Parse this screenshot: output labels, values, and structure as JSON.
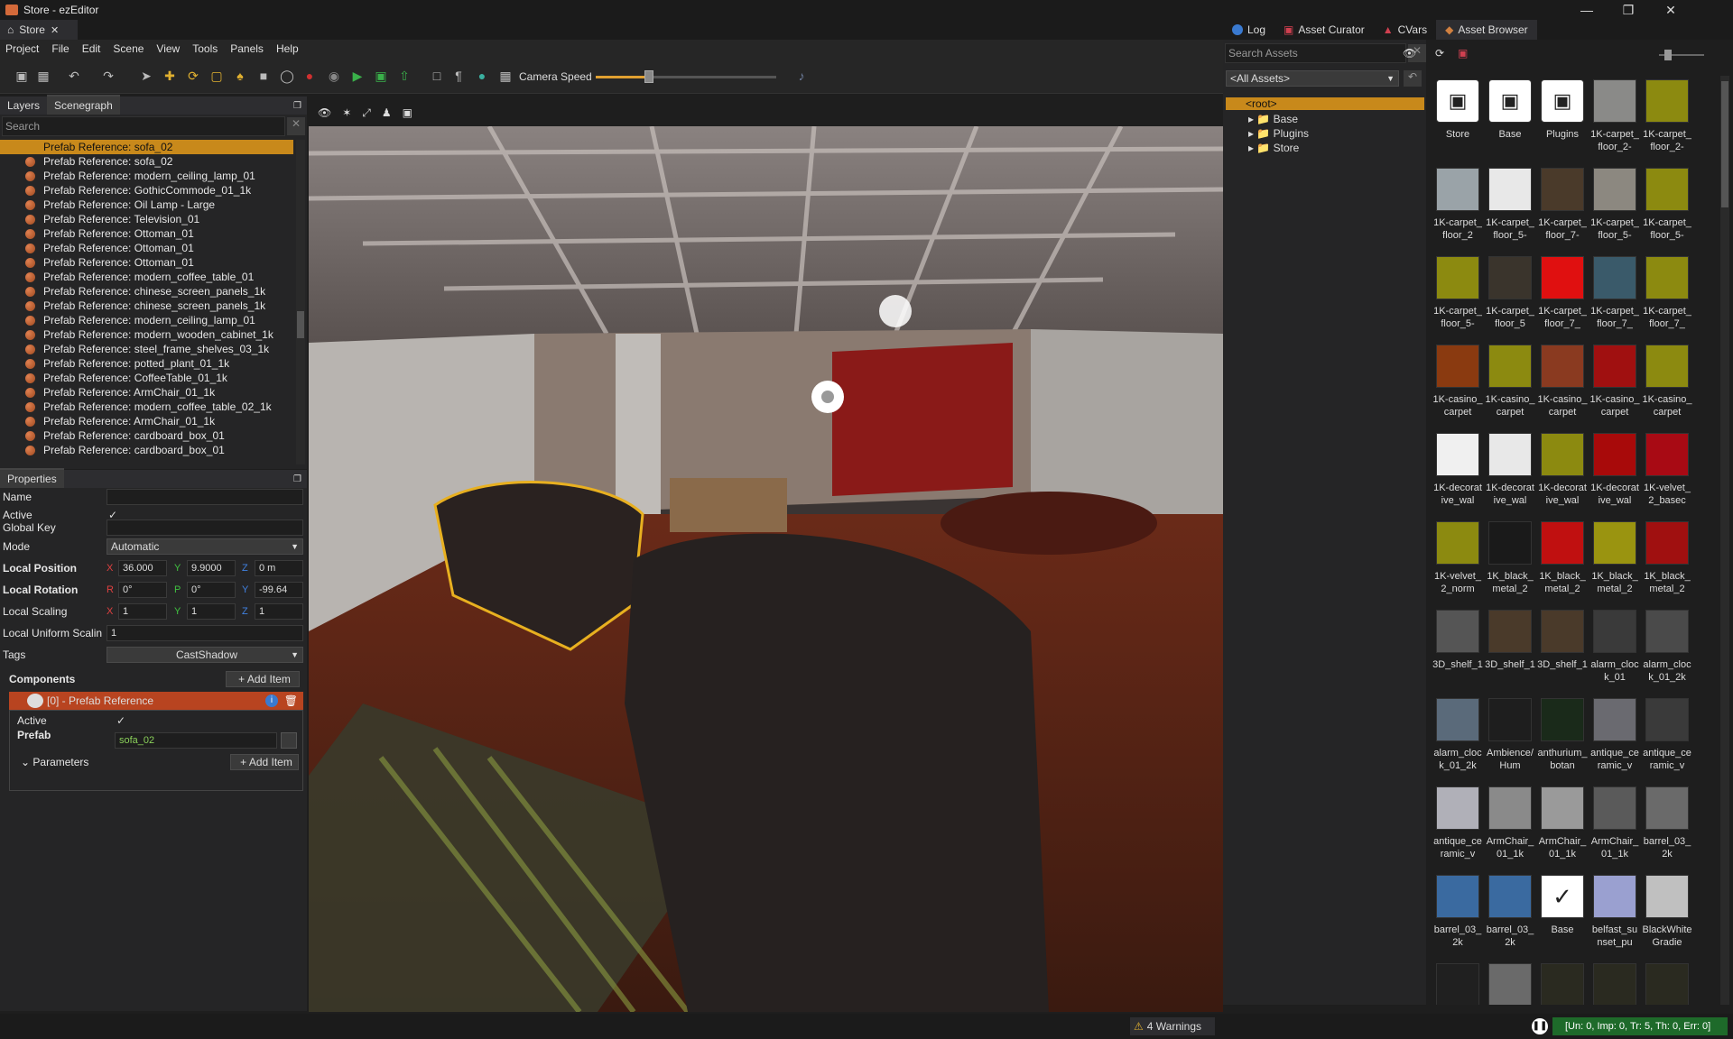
{
  "window": {
    "title": "Store - ezEditor",
    "doc_tab": "Store"
  },
  "menu": [
    "Project",
    "File",
    "Edit",
    "Scene",
    "View",
    "Tools",
    "Panels",
    "Help"
  ],
  "toolbar": {
    "camera_speed_label": "Camera Speed",
    "camera_speed_level": 0.3
  },
  "left_panel": {
    "tabs": [
      "Layers",
      "Scenegraph"
    ],
    "active_tab": "Scenegraph",
    "search_placeholder": "Search",
    "items": [
      "Prefab Reference: sofa_02",
      "Prefab Reference: sofa_02",
      "Prefab Reference: modern_ceiling_lamp_01",
      "Prefab Reference: GothicCommode_01_1k",
      "Prefab Reference: Oil Lamp - Large",
      "Prefab Reference: Television_01",
      "Prefab Reference: Ottoman_01",
      "Prefab Reference: Ottoman_01",
      "Prefab Reference: Ottoman_01",
      "Prefab Reference: modern_coffee_table_01",
      "Prefab Reference: chinese_screen_panels_1k",
      "Prefab Reference: chinese_screen_panels_1k",
      "Prefab Reference: modern_ceiling_lamp_01",
      "Prefab Reference: modern_wooden_cabinet_1k",
      "Prefab Reference: steel_frame_shelves_03_1k",
      "Prefab Reference: potted_plant_01_1k",
      "Prefab Reference: CoffeeTable_01_1k",
      "Prefab Reference: ArmChair_01_1k",
      "Prefab Reference: modern_coffee_table_02_1k",
      "Prefab Reference: ArmChair_01_1k",
      "Prefab Reference: cardboard_box_01",
      "Prefab Reference: cardboard_box_01"
    ]
  },
  "properties": {
    "title": "Properties",
    "name_label": "Name",
    "active_label": "Active",
    "global_key_label": "Global Key",
    "mode_label": "Mode",
    "mode_value": "Automatic",
    "local_position_label": "Local Position",
    "pos": {
      "x": "36.000",
      "y": "9.9000",
      "z": "0 m"
    },
    "local_rotation_label": "Local Rotation",
    "rot": {
      "r": "0°",
      "p": "0°",
      "y": "-99.64"
    },
    "local_scaling_label": "Local Scaling",
    "scale": {
      "x": "1",
      "y": "1",
      "z": "1"
    },
    "uniform_label": "Local Uniform Scalin",
    "uniform_value": "1",
    "tags_label": "Tags",
    "tags_value": "CastShadow",
    "components_label": "Components",
    "add_item": "Add Item",
    "component_title": "[0] - Prefab Reference",
    "comp_active": "Active",
    "prefab_label": "Prefab",
    "prefab_value": "sofa_02",
    "parameters_label": "Parameters"
  },
  "right_tabs": [
    "Log",
    "Asset Curator",
    "CVars",
    "Asset Browser"
  ],
  "assets": {
    "search_placeholder": "Search Assets",
    "filter": "<All Assets>",
    "root": "<root>",
    "tree": [
      "Base",
      "Plugins",
      "Store"
    ],
    "tiles": [
      {
        "name": "Store",
        "kind": "folder"
      },
      {
        "name": "Base",
        "kind": "folder"
      },
      {
        "name": "Plugins",
        "kind": "folder"
      },
      {
        "name": "1K-carpet_floor_2-",
        "color": "#8a8a88"
      },
      {
        "name": "1K-carpet_floor_2-",
        "color": "#8c8a10"
      },
      {
        "name": "1K-carpet_floor_2",
        "color": "#9aa3a8"
      },
      {
        "name": "1K-carpet_floor_5-",
        "color": "#e8e8e8"
      },
      {
        "name": "1K-carpet_floor_7-",
        "color": "#4a3a2a"
      },
      {
        "name": "1K-carpet_floor_5-",
        "color": "#8c8880"
      },
      {
        "name": "1K-carpet_floor_5-",
        "color": "#8c8a10"
      },
      {
        "name": "1K-carpet_floor_5-",
        "color": "#8c8a10"
      },
      {
        "name": "1K-carpet_floor_5",
        "color": "#3a342c"
      },
      {
        "name": "1K-carpet_floor_7_",
        "color": "#e01010"
      },
      {
        "name": "1K-carpet_floor_7_",
        "color": "#3a5a6a"
      },
      {
        "name": "1K-carpet_floor_7_",
        "color": "#8c8a10"
      },
      {
        "name": "1K-casino_carpet",
        "color": "#8a3a10"
      },
      {
        "name": "1K-casino_carpet",
        "color": "#8c8a10"
      },
      {
        "name": "1K-casino_carpet",
        "color": "#8a3a20"
      },
      {
        "name": "1K-casino_carpet",
        "color": "#a01010"
      },
      {
        "name": "1K-casino_carpet",
        "color": "#8c8a10"
      },
      {
        "name": "1K-decorative_wal",
        "color": "#f0f0f0"
      },
      {
        "name": "1K-decorative_wal",
        "color": "#e8e8e8"
      },
      {
        "name": "1K-decorative_wal",
        "color": "#8c8a10"
      },
      {
        "name": "1K-decorative_wal",
        "color": "#a80a0a"
      },
      {
        "name": "1K-velvet_2_basec",
        "color": "#a80a14"
      },
      {
        "name": "1K-velvet_2_norm",
        "color": "#8c8a10"
      },
      {
        "name": "1K_black_metal_2",
        "color": "#1a1a1a"
      },
      {
        "name": "1K_black_metal_2",
        "color": "#c01010"
      },
      {
        "name": "1K_black_metal_2",
        "color": "#9a9410"
      },
      {
        "name": "1K_black_metal_2",
        "color": "#a01010"
      },
      {
        "name": "3D_shelf_1",
        "color": "#555555"
      },
      {
        "name": "3D_shelf_1",
        "color": "#4a3a2a"
      },
      {
        "name": "3D_shelf_1",
        "color": "#4a3a2a"
      },
      {
        "name": "alarm_clock_01",
        "color": "#3a3a3a"
      },
      {
        "name": "alarm_clock_01_2k",
        "color": "#4a4a4a"
      },
      {
        "name": "alarm_clock_01_2k",
        "color": "#5a6a7a"
      },
      {
        "name": "Ambience/Hum",
        "color": "#1e1e1e"
      },
      {
        "name": "anthurium_botan",
        "color": "#1a2a1a"
      },
      {
        "name": "antique_ceramic_v",
        "color": "#6a6a70"
      },
      {
        "name": "antique_ceramic_v",
        "color": "#3a3a3a"
      },
      {
        "name": "antique_ceramic_v",
        "color": "#b0b0b8"
      },
      {
        "name": "ArmChair_01_1k",
        "color": "#8a8a8a"
      },
      {
        "name": "ArmChair_01_1k",
        "color": "#9a9a9a"
      },
      {
        "name": "ArmChair_01_1k",
        "color": "#5a5a5a"
      },
      {
        "name": "barrel_03_2k",
        "color": "#6a6a6a"
      },
      {
        "name": "barrel_03_2k",
        "color": "#3a6aa0"
      },
      {
        "name": "barrel_03_2k",
        "color": "#3a6aa0"
      },
      {
        "name": "Base",
        "kind": "check"
      },
      {
        "name": "belfast_sunset_pu",
        "color": "#9aa0d0"
      },
      {
        "name": "BlackWhiteGradie",
        "color": "#c0c0c0"
      },
      {
        "name": "",
        "color": "#202020"
      },
      {
        "name": "",
        "color": "#6a6a6a"
      },
      {
        "name": "",
        "color": "#2a2a20"
      },
      {
        "name": "",
        "color": "#2a2a20"
      },
      {
        "name": "",
        "color": "#2a2a20"
      }
    ]
  },
  "status": {
    "warnings": "4 Warnings",
    "counters": "[Un: 0, Imp: 0, Tr: 5, Th: 0, Err: 0]"
  }
}
